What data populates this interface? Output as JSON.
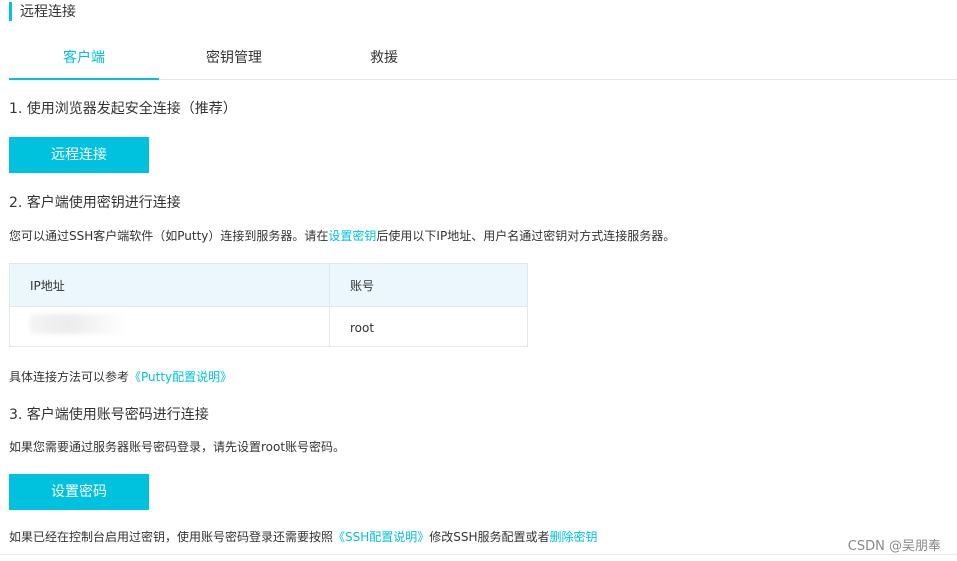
{
  "header": {
    "title": "远程连接"
  },
  "tabs": [
    {
      "label": "客户端",
      "active": true
    },
    {
      "label": "密钥管理",
      "active": false
    },
    {
      "label": "救援",
      "active": false
    }
  ],
  "section1": {
    "heading": "1. 使用浏览器发起安全连接（推荐）",
    "button_label": "远程连接"
  },
  "section2": {
    "heading": "2. 客户端使用密钥进行连接",
    "desc_prefix": "您可以通过SSH客户端软件（如Putty）连接到服务器。请在",
    "desc_link": "设置密钥",
    "desc_suffix": "后使用以下IP地址、用户名通过密钥对方式连接服务器。",
    "table": {
      "columns": [
        "IP地址",
        "账号"
      ],
      "rows": [
        {
          "ip": "",
          "account": "root"
        }
      ]
    },
    "ref_prefix": "具体连接方法可以参考",
    "ref_link": "《Putty配置说明》"
  },
  "section3": {
    "heading": "3. 客户端使用账号密码进行连接",
    "desc": "如果您需要通过服务器账号密码登录，请先设置root账号密码。",
    "button_label": "设置密码",
    "note_prefix": "如果已经在控制台启用过密钥，使用账号密码登录还需要按照",
    "note_link1": "《SSH配置说明》",
    "note_middle": "修改SSH服务配置或者",
    "note_link2": "删除密钥"
  },
  "watermark": "CSDN @吴朋奉",
  "colors": {
    "accent": "#00c1de",
    "table_header_bg": "#ebf6fd",
    "text": "#333333"
  }
}
